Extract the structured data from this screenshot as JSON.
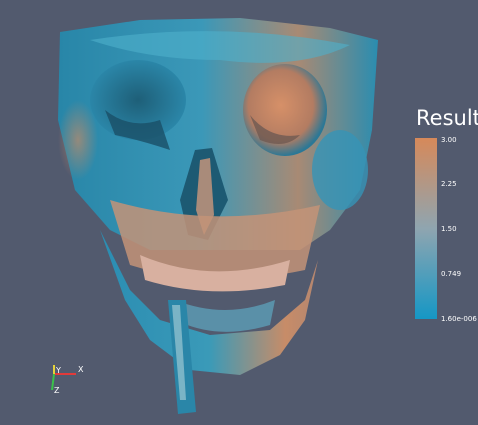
{
  "scalar_bar": {
    "title": "Result",
    "ticks": [
      "3.00",
      "2.25",
      "1.50",
      "0.749",
      "1.60e-006"
    ],
    "colors": {
      "high": "#d6895a",
      "mid": "#8fa5b0",
      "low": "#1597c5"
    }
  },
  "axes": {
    "x": "X",
    "y": "Y",
    "z": "Z"
  },
  "colors": {
    "background": "#525a6e",
    "surface_blue": "#2a8fb0",
    "surface_orange": "#c88a64"
  }
}
